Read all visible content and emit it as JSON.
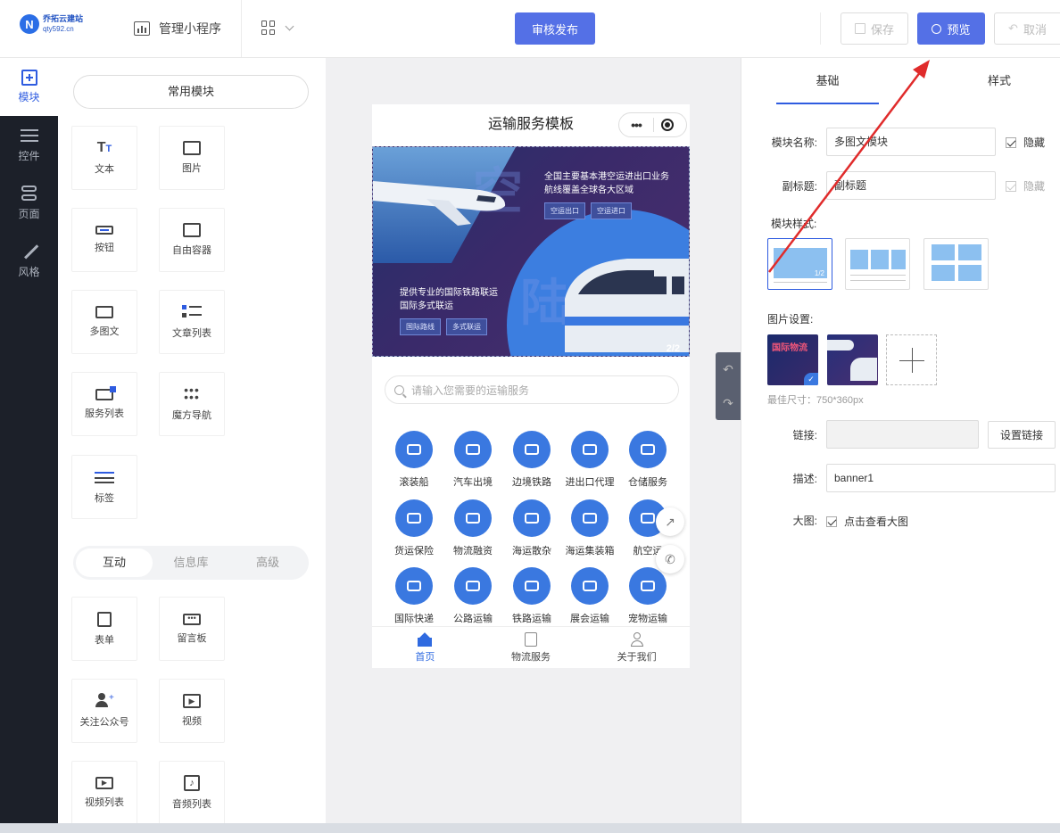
{
  "header": {
    "logo_text": "乔拓云建站",
    "logo_url_text": "qty592.cn",
    "manage_label": "管理小程序",
    "publish_label": "审核发布",
    "save_label": "保存",
    "preview_label": "预览",
    "cancel_label": "取消",
    "accent_color": "#5470e6"
  },
  "nav": {
    "items": [
      {
        "label": "模块",
        "icon": "plus-square-icon"
      },
      {
        "label": "控件",
        "icon": "sliders-icon"
      },
      {
        "label": "页面",
        "icon": "pages-icon"
      },
      {
        "label": "风格",
        "icon": "magic-wand-icon"
      }
    ]
  },
  "palette": {
    "common_label": "常用模块",
    "tiles": [
      {
        "label": "文本",
        "icon": "text-icon"
      },
      {
        "label": "图片",
        "icon": "image-icon"
      },
      {
        "label": "按钮",
        "icon": "button-icon"
      },
      {
        "label": "自由容器",
        "icon": "container-icon"
      },
      {
        "label": "多图文",
        "icon": "multi-image-text-icon"
      },
      {
        "label": "文章列表",
        "icon": "article-list-icon"
      },
      {
        "label": "服务列表",
        "icon": "service-list-icon"
      },
      {
        "label": "魔方导航",
        "icon": "cube-nav-icon"
      },
      {
        "label": "标签",
        "icon": "tag-icon"
      }
    ],
    "tabs": [
      {
        "label": "互动"
      },
      {
        "label": "信息库"
      },
      {
        "label": "高级"
      }
    ],
    "tiles2": [
      {
        "label": "表单",
        "icon": "form-icon"
      },
      {
        "label": "留言板",
        "icon": "message-board-icon"
      },
      {
        "label": "关注公众号",
        "icon": "follow-account-icon"
      },
      {
        "label": "视频",
        "icon": "video-icon"
      },
      {
        "label": "视频列表",
        "icon": "video-list-icon"
      },
      {
        "label": "音频列表",
        "icon": "audio-list-icon"
      }
    ]
  },
  "phone": {
    "title": "运输服务模板",
    "banner": {
      "text_top_1": "全国主要基本港空运进出口业务",
      "text_top_2": "航线覆盖全球各大区域",
      "tag_1": "空运出口",
      "tag_2": "空运进口",
      "text_bottom_1": "提供专业的国际铁路联运",
      "text_bottom_2": "国际多式联运",
      "tag_3": "国际路线",
      "tag_4": "多式联运",
      "bg_char_1": "空",
      "bg_char_2": "陆",
      "counter": "2/2"
    },
    "search_placeholder": "请输入您需要的运输服务",
    "services": [
      {
        "label": "滚装船",
        "icon": "roro-ship-icon"
      },
      {
        "label": "汽车出境",
        "icon": "car-icon"
      },
      {
        "label": "边境铁路",
        "icon": "train-icon"
      },
      {
        "label": "进出口代理",
        "icon": "agent-icon"
      },
      {
        "label": "仓储服务",
        "icon": "warehouse-icon"
      },
      {
        "label": "货运保险",
        "icon": "insurance-icon"
      },
      {
        "label": "物流融资",
        "icon": "finance-icon"
      },
      {
        "label": "海运散杂",
        "icon": "bulk-ship-icon"
      },
      {
        "label": "海运集装箱",
        "icon": "container-ship-icon"
      },
      {
        "label": "航空运",
        "icon": "plane-icon"
      },
      {
        "label": "国际快递",
        "icon": "express-icon"
      },
      {
        "label": "公路运输",
        "icon": "truck-icon"
      },
      {
        "label": "铁路运输",
        "icon": "rail-icon"
      },
      {
        "label": "展会运输",
        "icon": "exhibition-icon"
      },
      {
        "label": "宠物运输",
        "icon": "pet-icon"
      }
    ],
    "tabbar": [
      {
        "label": "首页",
        "icon": "home-icon"
      },
      {
        "label": "物流服务",
        "icon": "document-icon"
      },
      {
        "label": "关于我们",
        "icon": "user-icon"
      }
    ]
  },
  "settings": {
    "tab_basic": "基础",
    "tab_style": "样式",
    "module_name_label": "模块名称:",
    "module_name_value": "多图文模块",
    "hide_label": "隐藏",
    "subtitle_label": "副标题:",
    "subtitle_value": "副标题",
    "module_style_label": "模块样式:",
    "style_badge": "1/2",
    "image_settings_label": "图片设置:",
    "thumb_1_text": "国际物流",
    "best_size": "最佳尺寸：750*360px",
    "link_label": "链接:",
    "set_link_label": "设置链接",
    "desc_label": "描述:",
    "desc_value": "banner1",
    "big_image_label": "大图:",
    "big_image_check": "点击查看大图"
  }
}
